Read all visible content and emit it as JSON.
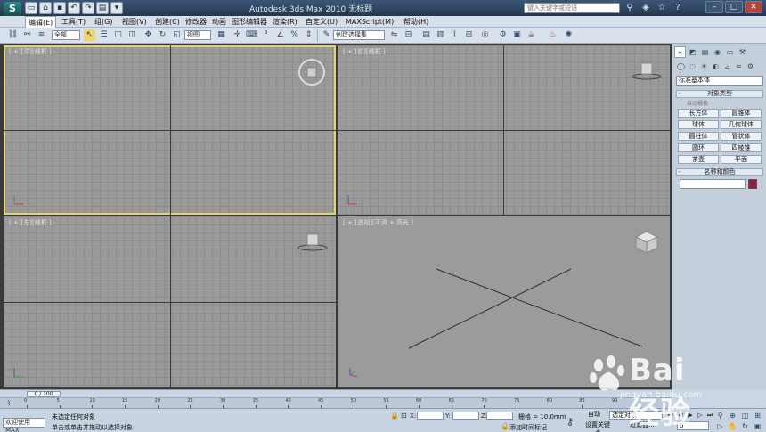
{
  "title_bar": {
    "app_logo": "S",
    "title": "Autodesk 3ds Max  2010     无标题",
    "search_placeholder": "键入关键字或短语",
    "win_min": "–",
    "win_max": "□",
    "win_close": "✕"
  },
  "menu": {
    "items": [
      "编辑(E)",
      "工具(T)",
      "组(G)",
      "视图(V)",
      "创建(C)",
      "修改器",
      "动画",
      "图形编辑器",
      "渲染(R)",
      "自定义(U)",
      "MAXScript(M)",
      "帮助(H)"
    ]
  },
  "toolbar": {
    "selection_filter": "全部",
    "ref_coord": "视图",
    "named_selection": "创建选择集"
  },
  "viewports": {
    "top_label": "[ +][顶][线框 ]",
    "front_label": "[ +][前][线框 ]",
    "left_label": "[ +][左][线框 ]",
    "persp_label": "[ +][透视][平滑 + 高光 ]"
  },
  "command_panel": {
    "category_dropdown": "标准基本体",
    "object_type_header": "对象类型",
    "autogrid": "自动栅格",
    "object_buttons": [
      "长方体",
      "圆锥体",
      "球体",
      "几何球体",
      "圆柱体",
      "管状体",
      "圆环",
      "四棱锥",
      "茶壶",
      "平面"
    ],
    "name_color_header": "名称和颜色"
  },
  "timeline": {
    "slider_label": "0 / 100",
    "ticks": [
      "0",
      "5",
      "10",
      "15",
      "20",
      "25",
      "30",
      "35",
      "40",
      "45",
      "50",
      "55",
      "60",
      "65",
      "70",
      "75",
      "80",
      "85",
      "90"
    ]
  },
  "status_bar": {
    "welcome": "欢迎使用 MAX",
    "status_line1": "未选定任何对象",
    "status_line2": "单击或单击并拖动以选择对象",
    "coord_x": "X:",
    "coord_y": "Y:",
    "coord_z": "Z:",
    "grid_text": "栅格 = 10.0mm",
    "add_time_tag": "添加时间标记",
    "auto_key": "自动",
    "set_key": "设置关键点",
    "selection_dropdown": "选定对象",
    "filters": "过滤器...",
    "frame_value": "0"
  },
  "watermark": {
    "brand": "Bai  经验",
    "url": "jingyan.baidu.com"
  }
}
